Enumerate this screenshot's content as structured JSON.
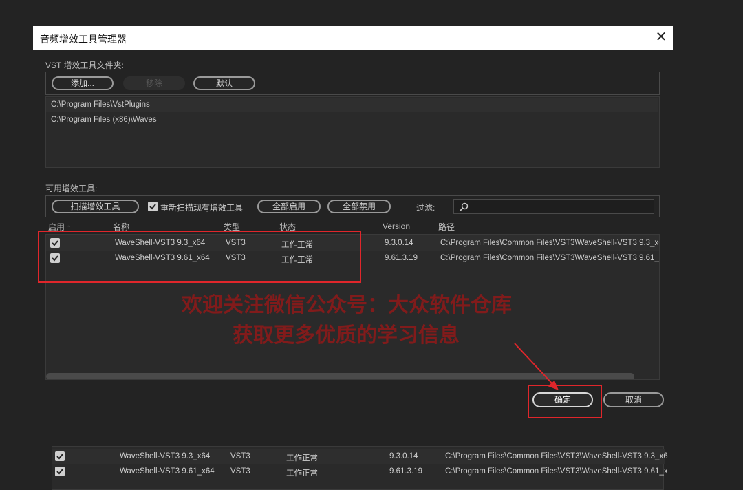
{
  "window": {
    "title": "音频增效工具管理器",
    "close_label": "✕"
  },
  "vst_folders": {
    "label": "VST 增效工具文件夹:",
    "add_label": "添加...",
    "remove_label": "移除",
    "default_label": "默认",
    "paths": [
      "C:\\Program Files\\VstPlugins",
      "C:\\Program Files (x86)\\Waves"
    ]
  },
  "plugins": {
    "label": "可用增效工具:",
    "scan_label": "扫描增效工具",
    "rescan_label": "重新扫描现有增效工具",
    "rescan_checked": true,
    "enable_all_label": "全部启用",
    "disable_all_label": "全部禁用",
    "filter_label": "过滤:",
    "filter_value": "",
    "columns": {
      "enabled": "启用",
      "name": "名称",
      "type": "类型",
      "status": "状态",
      "version": "Version",
      "path": "路径"
    },
    "rows": [
      {
        "enabled": true,
        "name": "WaveShell-VST3 9.3_x64",
        "type": "VST3",
        "status": "工作正常",
        "version": "9.3.0.14",
        "path": "C:\\Program Files\\Common Files\\VST3\\WaveShell-VST3 9.3_x6"
      },
      {
        "enabled": true,
        "name": "WaveShell-VST3 9.61_x64",
        "type": "VST3",
        "status": "工作正常",
        "version": "9.61.3.19",
        "path": "C:\\Program Files\\Common Files\\VST3\\WaveShell-VST3 9.61_x"
      }
    ]
  },
  "buttons": {
    "ok_label": "确定",
    "cancel_label": "取消"
  },
  "watermark": {
    "line1": "欢迎关注微信公众号：大众软件仓库",
    "line2": "获取更多优质的学习信息"
  },
  "zoom_inset": {
    "rows": [
      {
        "enabled": true,
        "name": "WaveShell-VST3 9.3_x64",
        "type": "VST3",
        "status": "工作正常",
        "version": "9.3.0.14",
        "path": "C:\\Program Files\\Common Files\\VST3\\WaveShell-VST3 9.3_x6"
      },
      {
        "enabled": true,
        "name": "WaveShell-VST3 9.61_x64",
        "type": "VST3",
        "status": "工作正常",
        "version": "9.61.3.19",
        "path": "C:\\Program Files\\Common Files\\VST3\\WaveShell-VST3 9.61_x"
      }
    ]
  },
  "colors": {
    "annotation_red": "#e0262b",
    "watermark_red": "#8b1a1a",
    "background": "#232323"
  }
}
